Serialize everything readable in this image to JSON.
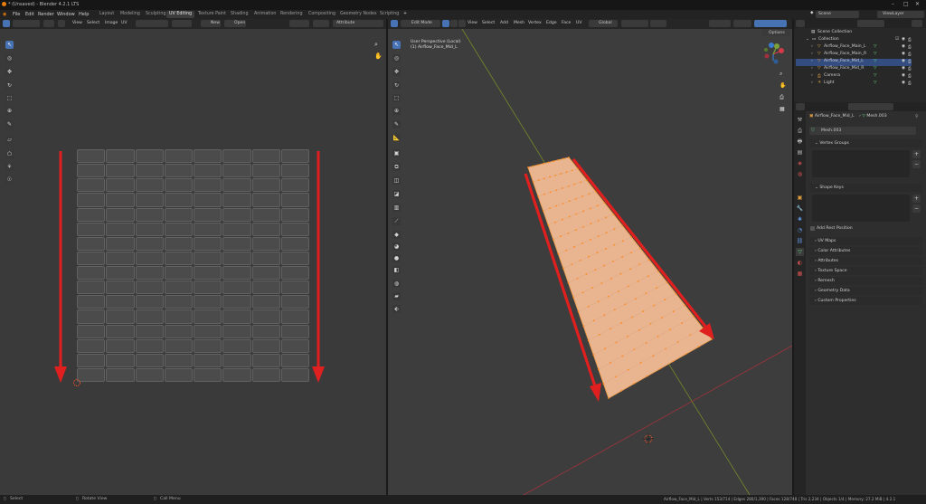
{
  "window": {
    "title": "* (Unsaved) - Blender 4.2.1 LTS"
  },
  "menus": [
    "File",
    "Edit",
    "Render",
    "Window",
    "Help"
  ],
  "workspaces": [
    "Layout",
    "Modeling",
    "Sculpting",
    "UV Editing",
    "Texture Paint",
    "Shading",
    "Animation",
    "Rendering",
    "Compositing",
    "Geometry Nodes",
    "Scripting"
  ],
  "active_workspace": "UV Editing",
  "top_right": {
    "scene": "Scene",
    "view_layer": "ViewLayer"
  },
  "uv_editor": {
    "menus": [
      "View",
      "Select",
      "Image",
      "UV"
    ],
    "new_label": "New",
    "open_label": "Open",
    "attribute_label": "Attribute",
    "grid_cols": 8,
    "grid_rows": 16
  },
  "viewport": {
    "mode": "Edit Mode",
    "menus": [
      "View",
      "Select",
      "Add",
      "Mesh",
      "Vertex",
      "Edge",
      "Face",
      "UV"
    ],
    "orientation": "Global",
    "options_label": "Options",
    "overlay_line1": "User Perspective (Local)",
    "overlay_line2": "(1) Airflow_Face_Mid_L"
  },
  "outliner": {
    "root": "Scene Collection",
    "collection": "Collection",
    "items": [
      "Airflow_Face_Main_L",
      "Airflow_Face_Main_R",
      "Airflow_Face_Mid_L",
      "Airflow_Face_Mid_R",
      "Camera",
      "Light"
    ]
  },
  "properties": {
    "breadcrumb_obj": "Airflow_Face_Mid_L",
    "breadcrumb_mesh": "Mesh.003",
    "mesh_name": "Mesh.003",
    "sections": {
      "vertex_groups": "Vertex Groups",
      "shape_keys": "Shape Keys",
      "add_rest": "Add Rest Position",
      "uv_maps": "UV Maps",
      "color_attributes": "Color Attributes",
      "attributes": "Attributes",
      "texture_space": "Texture Space",
      "remesh": "Remesh",
      "geometry_data": "Geometry Data",
      "custom_properties": "Custom Properties"
    }
  },
  "status": {
    "select": "Select",
    "rotate": "Rotate View",
    "call_menu": "Call Menu",
    "stats": "Airflow_Face_Mid_L | Verts 153/714 | Edges 280/1,390 | Faces 128/748 | Tris 2,234 | Objects 1/4 | Memory: 27.2 MiB | 4.2.1"
  },
  "colors": {
    "accent": "#4772b3",
    "arrow": "#e01f1f",
    "mesh_fill": "#e9b591",
    "vertex": "#ff8a1e",
    "x_axis": "#a0333b",
    "y_axis": "#748a2b"
  }
}
